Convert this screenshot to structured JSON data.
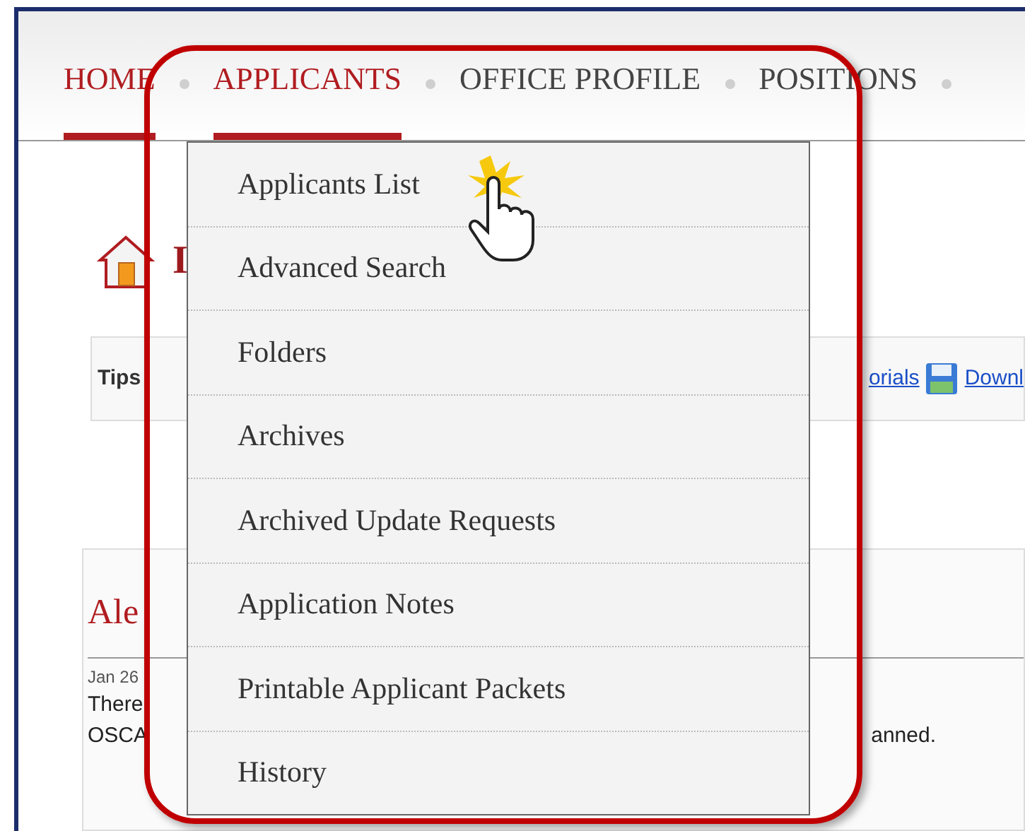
{
  "nav": [
    {
      "label": "HOME",
      "selected": true
    },
    {
      "label": "APPLICANTS",
      "selected": true
    },
    {
      "label": "OFFICE PROFILE",
      "selected": false
    },
    {
      "label": "POSITIONS",
      "selected": false
    }
  ],
  "dropdown": {
    "items": [
      "Applicants List",
      "Advanced Search",
      "Folders",
      "Archives",
      "Archived Update Requests",
      "Application Notes",
      "Printable Applicant Packets",
      "History"
    ]
  },
  "page_heading": "I",
  "tips": {
    "label": "Tips",
    "link_1": "orials",
    "link_2": "Downl"
  },
  "card": {
    "title": "Ale",
    "date": "Jan 26",
    "line_1": "There",
    "line_2": "OSCA",
    "line_2_end": "anned."
  }
}
